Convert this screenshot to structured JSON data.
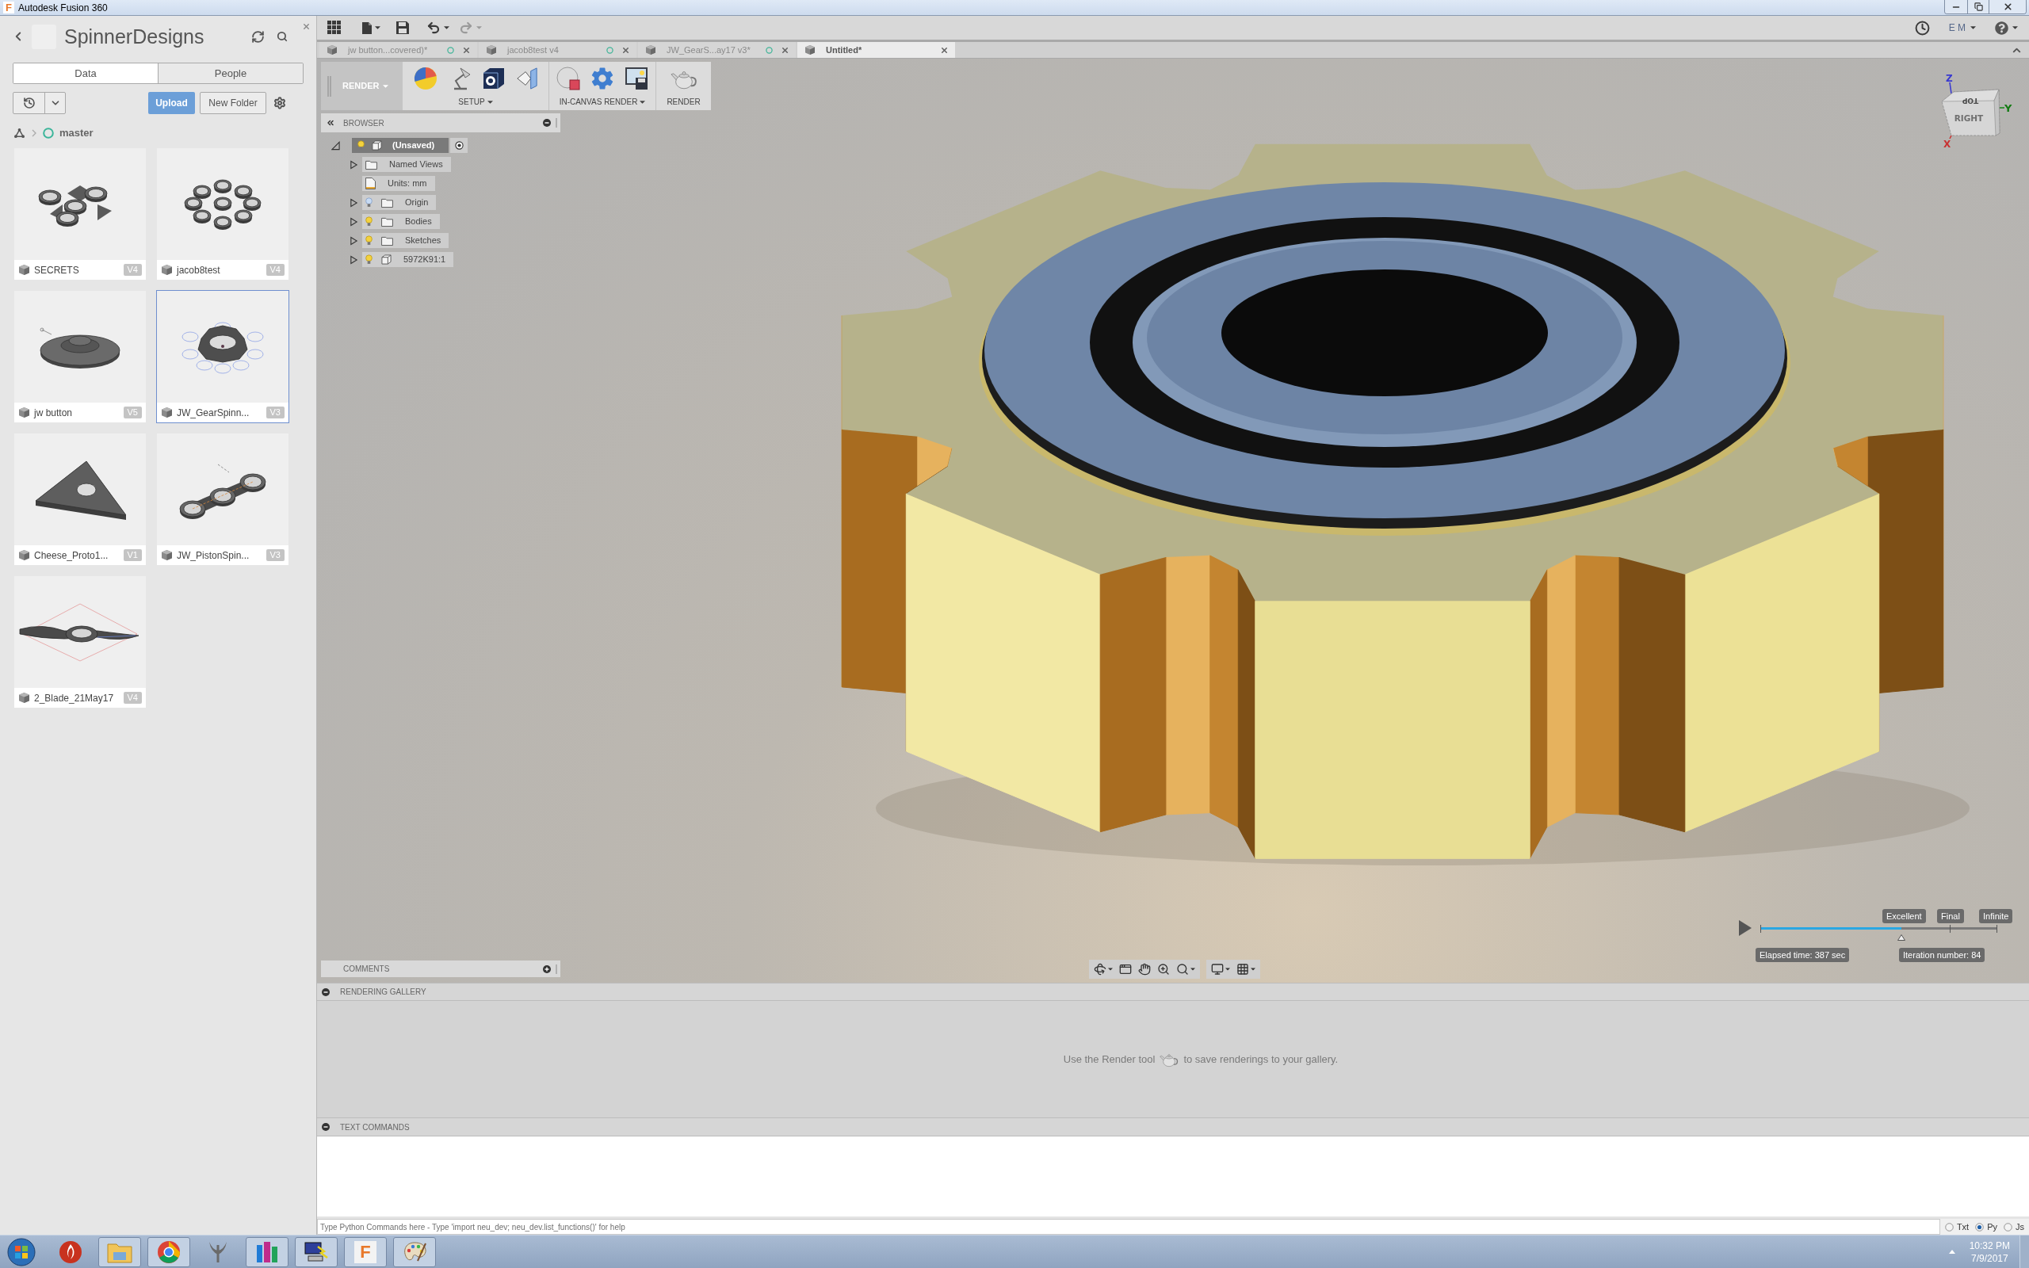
{
  "window": {
    "logo": "F",
    "title": "Autodesk Fusion 360"
  },
  "data_panel": {
    "project": "SpinnerDesigns",
    "tabs": [
      {
        "label": "Data",
        "selected": true
      },
      {
        "label": "People",
        "selected": false
      }
    ],
    "upload": "Upload",
    "new_folder": "New Folder",
    "breadcrumb": "master",
    "files": [
      {
        "name": "SECRETS",
        "version": "V4",
        "selected": false
      },
      {
        "name": "jacob8test",
        "version": "V4",
        "selected": false
      },
      {
        "name": "jw button",
        "version": "V5",
        "selected": false
      },
      {
        "name": "JW_GearSpinn...",
        "version": "V3",
        "selected": true
      },
      {
        "name": "Cheese_Proto1...",
        "version": "V1",
        "selected": false
      },
      {
        "name": "JW_PistonSpin...",
        "version": "V3",
        "selected": false
      },
      {
        "name": "2_Blade_21May17",
        "version": "V4",
        "selected": false
      }
    ]
  },
  "toolbar": {
    "undo": {
      "disabled": false
    },
    "redo": {
      "disabled": true
    },
    "user": "E M"
  },
  "document_tabs": [
    {
      "label": "jw button...covered)*",
      "selected": false,
      "saved": true
    },
    {
      "label": "jacob8test v4",
      "selected": false,
      "saved": true
    },
    {
      "label": "JW_GearS...ay17 v3*",
      "selected": false,
      "saved": true
    },
    {
      "label": "Untitled*",
      "selected": true,
      "saved": false
    }
  ],
  "ribbon": {
    "workspace": "RENDER",
    "groups": [
      {
        "kind": "setup",
        "label": "SETUP",
        "dropdown": true
      },
      {
        "kind": "in_canvas",
        "label": "IN-CANVAS RENDER",
        "dropdown": true
      },
      {
        "kind": "render",
        "label": "RENDER",
        "dropdown": false
      }
    ]
  },
  "browser": {
    "title": "BROWSER",
    "root": {
      "label": "(Unsaved)",
      "expanded": true,
      "visible": true,
      "children": [
        {
          "kind": "folder",
          "label": "Named Views",
          "expanded": false
        },
        {
          "kind": "units",
          "label": "Units: mm"
        },
        {
          "kind": "folder",
          "label": "Origin",
          "expanded": false,
          "visible": false
        },
        {
          "kind": "folder",
          "label": "Bodies",
          "expanded": false,
          "visible": true
        },
        {
          "kind": "folder",
          "label": "Sketches",
          "expanded": false,
          "visible": true
        },
        {
          "kind": "component",
          "label": "5972K91:1",
          "expanded": false,
          "visible": true
        }
      ]
    }
  },
  "view_cube": {
    "top": "TOP",
    "face": "RIGHT",
    "axes": {
      "z": "Z",
      "y": "Y",
      "x": "X"
    }
  },
  "render_progress": {
    "level": 0.595,
    "marks": [
      "Excellent",
      "Final",
      "Infinite"
    ],
    "elapsed": "Elapsed time: 387 sec",
    "iteration": "Iteration number: 84"
  },
  "comments": {
    "title": "COMMENTS"
  },
  "rendering_gallery": {
    "title": "RENDERING GALLERY",
    "hint_before": "Use the Render tool",
    "hint_after": "to save renderings to your gallery."
  },
  "text_commands": {
    "title": "TEXT COMMANDS",
    "placeholder": "Type Python Commands here - Type 'import neu_dev; neu_dev.list_functions()' for help",
    "modes": [
      {
        "label": "Txt",
        "selected": false
      },
      {
        "label": "Py",
        "selected": true
      },
      {
        "label": "Js",
        "selected": false
      }
    ]
  },
  "taskbar": {
    "apps": [
      {
        "kind": "flame",
        "running": false
      },
      {
        "kind": "folder",
        "running": true
      },
      {
        "kind": "browser",
        "running": true
      },
      {
        "kind": "trident",
        "running": false
      },
      {
        "kind": "bars",
        "running": true
      },
      {
        "kind": "computer",
        "running": true
      },
      {
        "kind": "letter",
        "label": "F",
        "running": true
      },
      {
        "kind": "palette",
        "running": true
      }
    ],
    "time": "10:32 PM",
    "date": "7/9/2017"
  }
}
